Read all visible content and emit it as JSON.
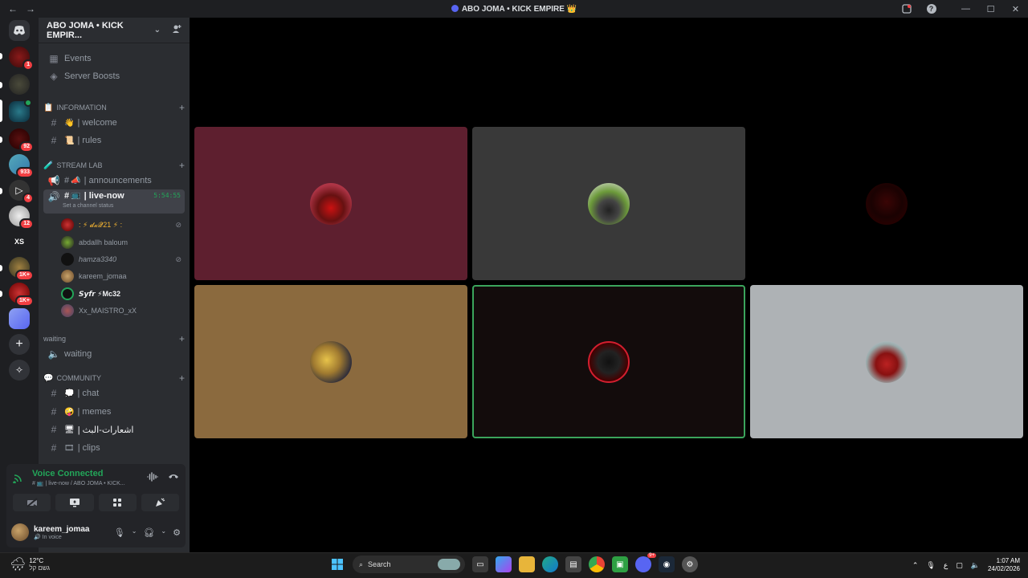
{
  "window": {
    "title": "ABO JOMA • KICK EMPIRE 👑",
    "back": "←",
    "forward": "→",
    "minimize": "—",
    "maximize": "☐",
    "close": "✕",
    "help": "?"
  },
  "guilds": {
    "badges": [
      "1",
      "92",
      "933",
      "4",
      "12",
      "1K+",
      "1K+"
    ],
    "xs_label": "XS",
    "add": "+",
    "explore": "✧"
  },
  "server": {
    "name": "ABO JOMA • KICK EMPIR...",
    "events": "Events",
    "boosts": "Server Boosts"
  },
  "categories": {
    "information": "INFORMATION",
    "stream_lab": "STREAM LAB",
    "waiting": "waiting",
    "community": "COMMUNITY"
  },
  "channels": {
    "welcome": "| welcome",
    "rules": "| rules",
    "announcements": "| announcements",
    "live_now": "| live-now",
    "live_time": "5:54:55",
    "channel_status": "Set a channel status",
    "waiting": "waiting",
    "chat": "| chat",
    "memes": "| memes",
    "arabic": "| اشعارات-البث",
    "clips": "| clips"
  },
  "voice_users": [
    {
      "name": ": ⚡ 𝓭𝔁𝓠21 ⚡ :"
    },
    {
      "name": "abdallh baloum"
    },
    {
      "name": "hamza3340"
    },
    {
      "name": "kareem_jomaa"
    },
    {
      "name": "𝙎𝙮𝙛𝙧 ⚡Mc32"
    },
    {
      "name": "Xx_MAISTRO_xX"
    }
  ],
  "voice_panel": {
    "status": "Voice Connected",
    "subtitle": "# 📺 | live-now / ABO JOMA • KICK..."
  },
  "user": {
    "name": "kareem_jomaa",
    "status": "In voice"
  },
  "taskbar": {
    "temp": "12°C",
    "weather_desc": "גשם קל",
    "search": "Search",
    "discord_badge": "9+",
    "lang": "ع",
    "time": "1:07 AM",
    "date": "24/02/2026"
  },
  "colors": {
    "tile_red": "#5e1f2f",
    "tile_gray": "#393939",
    "tile_brown": "#8b6a3e",
    "tile_dark": "#130c0c",
    "tile_light": "#aeb2b5",
    "accent_green": "#23a559"
  }
}
